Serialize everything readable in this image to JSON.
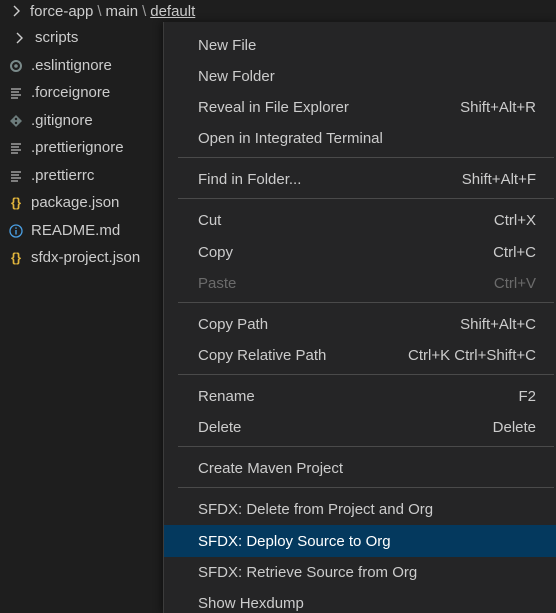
{
  "breadcrumb": {
    "segments": [
      "force-app",
      "main",
      "default"
    ]
  },
  "explorer": {
    "items": [
      {
        "label": "scripts",
        "icon": "chevron-right-icon"
      },
      {
        "label": ".eslintignore",
        "icon": "circle-icon"
      },
      {
        "label": ".forceignore",
        "icon": "lines-icon"
      },
      {
        "label": ".gitignore",
        "icon": "git-icon"
      },
      {
        "label": ".prettierignore",
        "icon": "lines-icon"
      },
      {
        "label": ".prettierrc",
        "icon": "lines-icon"
      },
      {
        "label": "package.json",
        "icon": "braces-icon"
      },
      {
        "label": "README.md",
        "icon": "info-icon"
      },
      {
        "label": "sfdx-project.json",
        "icon": "braces-icon"
      }
    ]
  },
  "menu": {
    "items": [
      {
        "label": "New File",
        "shortcut": ""
      },
      {
        "label": "New Folder",
        "shortcut": ""
      },
      {
        "label": "Reveal in File Explorer",
        "shortcut": "Shift+Alt+R"
      },
      {
        "label": "Open in Integrated Terminal",
        "shortcut": ""
      },
      {
        "label": "Find in Folder...",
        "shortcut": "Shift+Alt+F"
      },
      {
        "label": "Cut",
        "shortcut": "Ctrl+X"
      },
      {
        "label": "Copy",
        "shortcut": "Ctrl+C"
      },
      {
        "label": "Paste",
        "shortcut": "Ctrl+V"
      },
      {
        "label": "Copy Path",
        "shortcut": "Shift+Alt+C"
      },
      {
        "label": "Copy Relative Path",
        "shortcut": "Ctrl+K Ctrl+Shift+C"
      },
      {
        "label": "Rename",
        "shortcut": "F2"
      },
      {
        "label": "Delete",
        "shortcut": "Delete"
      },
      {
        "label": "Create Maven Project",
        "shortcut": ""
      },
      {
        "label": "SFDX: Delete from Project and Org",
        "shortcut": ""
      },
      {
        "label": "SFDX: Deploy Source to Org",
        "shortcut": ""
      },
      {
        "label": "SFDX: Retrieve Source from Org",
        "shortcut": ""
      },
      {
        "label": "Show Hexdump",
        "shortcut": ""
      }
    ]
  },
  "colors": {
    "background": "#1e1e1e",
    "menu_background": "#252526",
    "highlight": "#04395e",
    "json_icon": "#e0b43c",
    "info_icon": "#4a9fe3"
  }
}
